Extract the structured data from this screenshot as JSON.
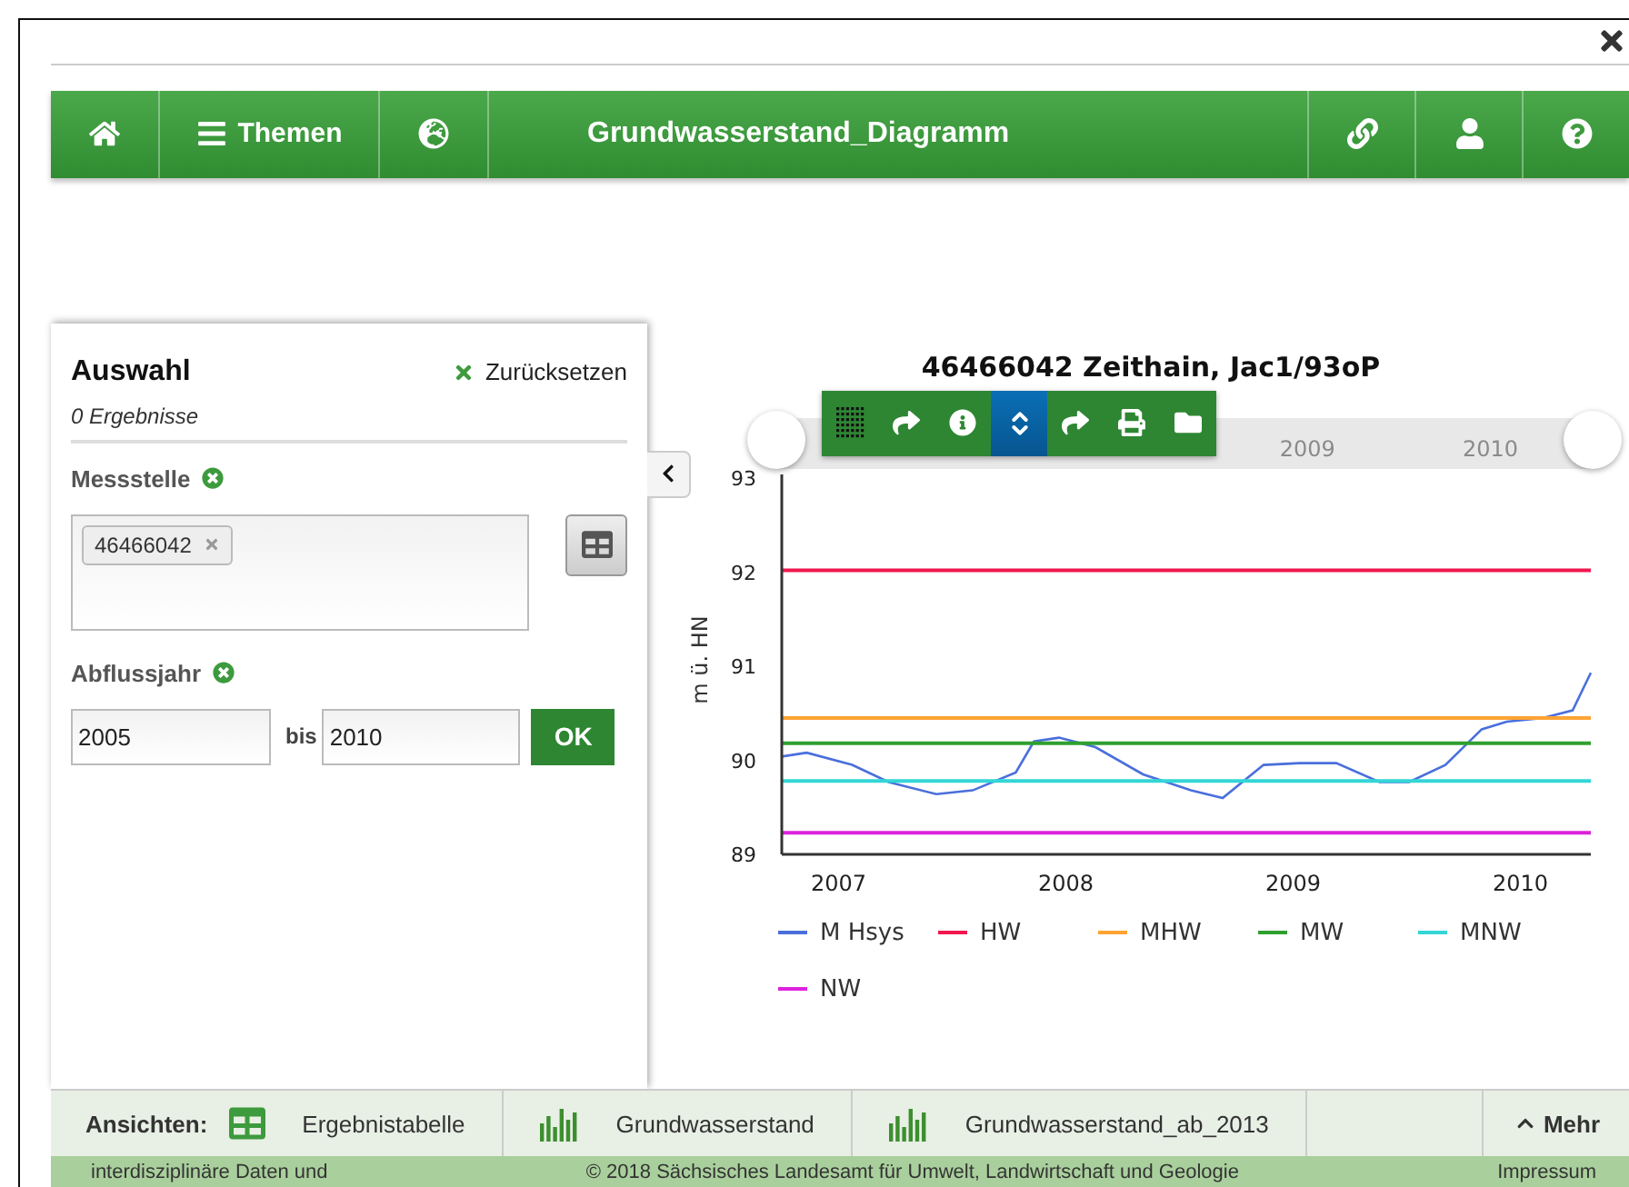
{
  "nav": {
    "left": [
      {
        "kind": "home"
      },
      {
        "kind": "menu",
        "label": "Themen"
      },
      {
        "kind": "globe"
      }
    ],
    "title": "Grundwasserstand_Diagramm",
    "right": [
      {
        "kind": "link"
      },
      {
        "kind": "user"
      },
      {
        "kind": "help"
      }
    ]
  },
  "panel": {
    "title": "Auswahl",
    "reset": "Zurücksetzen",
    "results": "0 Ergebnisse",
    "station_label": "Messstelle",
    "station_tags": [
      "46466042"
    ],
    "year_label": "Abflussjahr",
    "from": "2005",
    "between": "bis",
    "to": "2010",
    "ok": "OK"
  },
  "chart": {
    "title": "46466042 Zeithain, Jac1/93oP",
    "tools": [
      {
        "kind": "grid",
        "selected": false
      },
      {
        "kind": "redo",
        "selected": false
      },
      {
        "kind": "info",
        "selected": false
      },
      {
        "kind": "updown",
        "selected": true
      },
      {
        "kind": "redo",
        "selected": false
      },
      {
        "kind": "print",
        "selected": false
      },
      {
        "kind": "folder",
        "selected": false
      }
    ],
    "navigator_labels": [
      "2009",
      "2010"
    ],
    "chart_data": {
      "type": "line",
      "ylabel": "m ü. HN",
      "x": [
        2006.75,
        2006.86,
        2007.06,
        2007.22,
        2007.43,
        2007.59,
        2007.78,
        2007.86,
        2007.97,
        2008.13,
        2008.34,
        2008.55,
        2008.69,
        2008.87,
        2009.03,
        2009.19,
        2009.38,
        2009.51,
        2009.67,
        2009.83,
        2009.94,
        2010.1,
        2010.23,
        2010.31
      ],
      "xlim": [
        2006.75,
        2010.31
      ],
      "ylim": [
        89,
        93
      ],
      "xticks": [
        2007,
        2008,
        2009,
        2010
      ],
      "yticks": [
        89,
        90,
        91,
        92,
        93
      ],
      "series": [
        {
          "name": "M Hsys",
          "color": "#4a6fdc",
          "values": [
            90.04,
            90.08,
            89.95,
            89.77,
            89.64,
            89.68,
            89.87,
            90.2,
            90.24,
            90.14,
            89.85,
            89.68,
            89.6,
            89.95,
            89.97,
            89.97,
            89.77,
            89.77,
            89.95,
            90.33,
            90.41,
            90.45,
            90.53,
            90.93
          ]
        },
        {
          "name": "HW",
          "color": "#f0174d",
          "values": [
            92.02,
            92.02,
            92.02,
            92.02,
            92.02,
            92.02,
            92.02,
            92.02,
            92.02,
            92.02,
            92.02,
            92.02,
            92.02,
            92.02,
            92.02,
            92.02,
            92.02,
            92.02,
            92.02,
            92.02,
            92.02,
            92.02,
            92.02,
            92.02
          ]
        },
        {
          "name": "MHW",
          "color": "#ffa333",
          "values": [
            90.45,
            90.45,
            90.45,
            90.45,
            90.45,
            90.45,
            90.45,
            90.45,
            90.45,
            90.45,
            90.45,
            90.45,
            90.45,
            90.45,
            90.45,
            90.45,
            90.45,
            90.45,
            90.45,
            90.45,
            90.45,
            90.45,
            90.45,
            90.45
          ]
        },
        {
          "name": "MW",
          "color": "#2ea02e",
          "values": [
            90.18,
            90.18,
            90.18,
            90.18,
            90.18,
            90.18,
            90.18,
            90.18,
            90.18,
            90.18,
            90.18,
            90.18,
            90.18,
            90.18,
            90.18,
            90.18,
            90.18,
            90.18,
            90.18,
            90.18,
            90.18,
            90.18,
            90.18,
            90.18
          ]
        },
        {
          "name": "MNW",
          "color": "#33d6d6",
          "values": [
            89.78,
            89.78,
            89.78,
            89.78,
            89.78,
            89.78,
            89.78,
            89.78,
            89.78,
            89.78,
            89.78,
            89.78,
            89.78,
            89.78,
            89.78,
            89.78,
            89.78,
            89.78,
            89.78,
            89.78,
            89.78,
            89.78,
            89.78,
            89.78
          ]
        },
        {
          "name": "NW",
          "color": "#dd22dd",
          "values": [
            89.23,
            89.23,
            89.23,
            89.23,
            89.23,
            89.23,
            89.23,
            89.23,
            89.23,
            89.23,
            89.23,
            89.23,
            89.23,
            89.23,
            89.23,
            89.23,
            89.23,
            89.23,
            89.23,
            89.23,
            89.23,
            89.23,
            89.23,
            89.23
          ]
        }
      ]
    }
  },
  "views": {
    "label": "Ansichten:",
    "items": [
      {
        "kind": "table",
        "label": "Ergebnistabelle"
      },
      {
        "kind": "bars",
        "label": "Grundwasserstand"
      },
      {
        "kind": "bars",
        "label": "Grundwasserstand_ab_2013"
      }
    ],
    "more": "Mehr"
  },
  "footer": {
    "left": "interdisziplinäre Daten und",
    "center": "© 2018 Sächsisches Landesamt für Umwelt, Landwirtschaft und Geologie",
    "right": "Impressum"
  }
}
